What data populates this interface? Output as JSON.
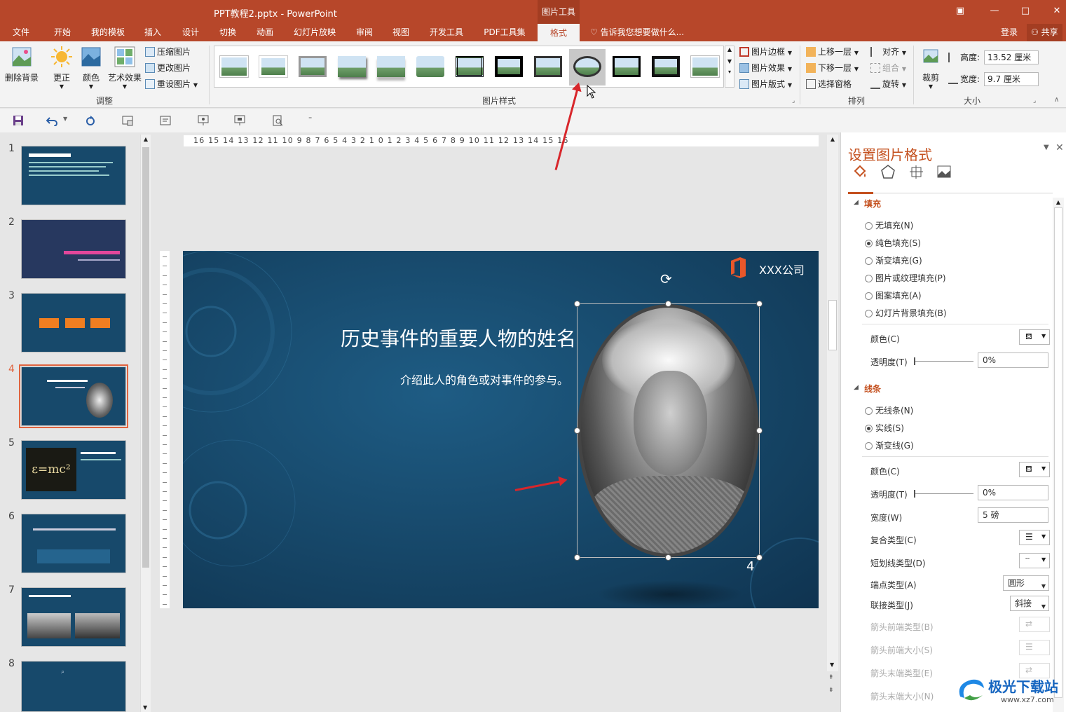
{
  "window": {
    "title": "PPT教程2.pptx - PowerPoint",
    "context_tab_group": "图片工具"
  },
  "tabs": [
    {
      "label": "文件"
    },
    {
      "label": "开始"
    },
    {
      "label": "我的模板"
    },
    {
      "label": "插入"
    },
    {
      "label": "设计"
    },
    {
      "label": "切换"
    },
    {
      "label": "动画"
    },
    {
      "label": "幻灯片放映"
    },
    {
      "label": "审阅"
    },
    {
      "label": "视图"
    },
    {
      "label": "开发工具"
    },
    {
      "label": "PDF工具集"
    },
    {
      "label": "格式",
      "active": true
    }
  ],
  "tell_me": "告诉我您想要做什么...",
  "account": {
    "login": "登录",
    "share": "共享"
  },
  "ribbon": {
    "adjust": {
      "label": "调整",
      "remove_bg": "删除背景",
      "corrections": "更正",
      "color": "颜色",
      "artistic": "艺术效果",
      "compress": "压缩图片",
      "change": "更改图片",
      "reset": "重设图片"
    },
    "styles": {
      "label": "图片样式",
      "border": "图片边框",
      "effects": "图片效果",
      "layout": "图片版式",
      "selected_index": 9
    },
    "arrange": {
      "label": "排列",
      "bring_forward": "上移一层",
      "send_backward": "下移一层",
      "selection_pane": "选择窗格",
      "align": "对齐",
      "group": "组合",
      "rotate": "旋转"
    },
    "size": {
      "label": "大小",
      "crop": "裁剪",
      "height_label": "高度:",
      "height": "13.52 厘米",
      "width_label": "宽度:",
      "width": "9.7 厘米"
    }
  },
  "ruler": {
    "horizontal": "16 15 14 13 12 11 10 9 8 7 6 5 4 3 2 1 0 1 2 3 4 5 6 7 8 9 10 11 12 13 14 15 16"
  },
  "slides": [
    {
      "num": "1"
    },
    {
      "num": "2"
    },
    {
      "num": "3"
    },
    {
      "num": "4",
      "selected": true
    },
    {
      "num": "5"
    },
    {
      "num": "6"
    },
    {
      "num": "7"
    },
    {
      "num": "8"
    }
  ],
  "current_slide": {
    "title": "历史事件的重要人物的姓名",
    "subtitle": "介绍此人的角色或对事件的参与。",
    "company": "XXX公司",
    "page_number": "4"
  },
  "format_pane": {
    "title": "设置图片格式",
    "fill": {
      "header": "填充",
      "options": [
        "无填充(N)",
        "纯色填充(S)",
        "渐变填充(G)",
        "图片或纹理填充(P)",
        "图案填充(A)",
        "幻灯片背景填充(B)"
      ],
      "selected": 1,
      "color_label": "颜色(C)",
      "transparency_label": "透明度(T)",
      "transparency": "0%"
    },
    "line": {
      "header": "线条",
      "options": [
        "无线条(N)",
        "实线(S)",
        "渐变线(G)"
      ],
      "selected": 1,
      "color_label": "颜色(C)",
      "transparency_label": "透明度(T)",
      "transparency": "0%",
      "width_label": "宽度(W)",
      "width": "5 磅",
      "compound_label": "复合类型(C)",
      "dash_label": "短划线类型(D)",
      "cap_label": "端点类型(A)",
      "cap": "圆形",
      "join_label": "联接类型(J)",
      "join": "斜接",
      "begin_arrow_type": "箭头前端类型(B)",
      "begin_arrow_size": "箭头前端大小(S)",
      "end_arrow_type": "箭头末端类型(E)",
      "end_arrow_size": "箭头末端大小(N)"
    }
  },
  "watermark": {
    "text": "极光下载站",
    "url": "www.xz7.com"
  },
  "colors": {
    "accent": "#b7472a",
    "pane_accent": "#c4501e",
    "slide_bg": "#17496b"
  }
}
